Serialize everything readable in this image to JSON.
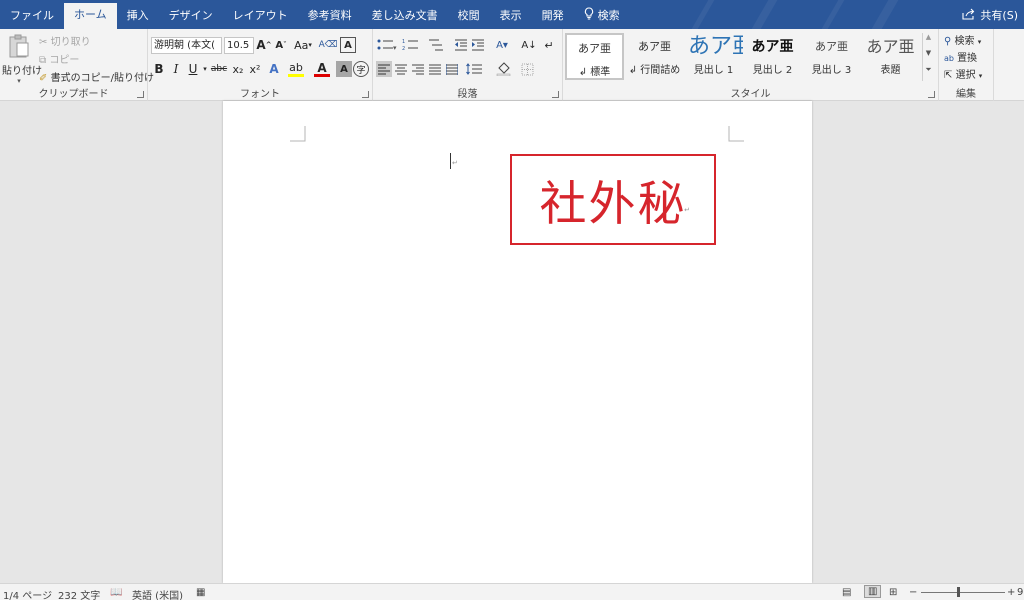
{
  "tabs": [
    {
      "label": "ファイル"
    },
    {
      "label": "ホーム",
      "active": true
    },
    {
      "label": "挿入"
    },
    {
      "label": "デザイン"
    },
    {
      "label": "レイアウト"
    },
    {
      "label": "参考資料"
    },
    {
      "label": "差し込み文書"
    },
    {
      "label": "校閲"
    },
    {
      "label": "表示"
    },
    {
      "label": "開発"
    },
    {
      "label": "検索",
      "icon": "lightbulb-icon"
    }
  ],
  "share": {
    "label": "共有(S)"
  },
  "clipboard": {
    "paste": "貼り付け",
    "cut": "切り取り",
    "copy": "コピー",
    "format_painter": "書式のコピー/貼り付け",
    "group_label": "クリップボード"
  },
  "font": {
    "name": "游明朝 (本文(",
    "size": "10.5",
    "case_btn": "Aa",
    "group_label": "フォント",
    "bold": "B",
    "italic": "I",
    "underline": "U",
    "strike": "abc",
    "sub": "x₂",
    "sup": "x²"
  },
  "paragraph": {
    "group_label": "段落"
  },
  "styles": {
    "group_label": "スタイル",
    "items": [
      {
        "preview": "あア亜",
        "name": "↲ 標準",
        "selected": true
      },
      {
        "preview": "あア亜",
        "name": "↲ 行間詰め"
      },
      {
        "preview": "あア亜",
        "name": "見出し 1"
      },
      {
        "preview": "あア亜",
        "name": "見出し 2"
      },
      {
        "preview": "あア亜",
        "name": "見出し 3"
      },
      {
        "preview": "あア亜",
        "name": "表題"
      }
    ]
  },
  "editing": {
    "find": "検索",
    "replace": "置換",
    "select": "選択",
    "group_label": "編集"
  },
  "document": {
    "stamp_text": "社外秘"
  },
  "status": {
    "page": "1/4 ページ",
    "words": "232 文字",
    "language": "英語 (米国)",
    "zoom": "9"
  },
  "colors": {
    "accent": "#2b579a",
    "stamp": "#d6252c",
    "heading1": "#2e74b5"
  }
}
